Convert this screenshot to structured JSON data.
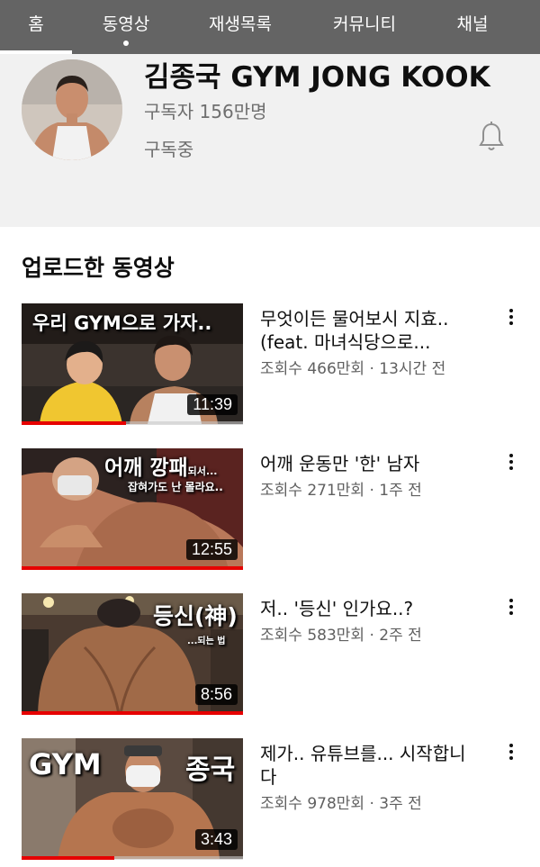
{
  "tabs": [
    {
      "label": "홈",
      "active": true
    },
    {
      "label": "동영상",
      "active": false
    },
    {
      "label": "재생목록",
      "active": false
    },
    {
      "label": "커뮤니티",
      "active": false
    },
    {
      "label": "채널",
      "active": false
    }
  ],
  "channel": {
    "title": "김종국 GYM JONG KOOK",
    "subscribers": "구독자 156만명",
    "subscribe_status": "구독중"
  },
  "section_title": "업로드한 동영상",
  "videos": [
    {
      "title": "무엇이든 물어보시 지효.. (feat. 마녀식당으로...",
      "meta": "조회수 466만회 · 13시간 전",
      "duration": "11:39",
      "watch_progress": 0.47,
      "thumb_text": "우리 GYM으로 가자.."
    },
    {
      "title": "어깨 운동만 '한' 남자",
      "meta": "조회수 271만회 · 1주 전",
      "duration": "12:55",
      "watch_progress": 1.0,
      "thumb_text": "어깨 깡패",
      "thumb_text_small": "되서...",
      "thumb_subtext": "잡혀가도 난 몰라요.."
    },
    {
      "title": "저.. '등신' 인가요..?",
      "meta": "조회수 583만회 · 2주 전",
      "duration": "8:56",
      "watch_progress": 1.0,
      "thumb_text": "등신(神)",
      "thumb_subtext": "...되는 법"
    },
    {
      "title": "제가.. 유튜브를... 시작합니다",
      "meta": "조회수 978만회 · 3주 전",
      "duration": "3:43",
      "watch_progress": 0.42,
      "thumb_text_left": "GYM",
      "thumb_text_right": "종국"
    }
  ],
  "icons": {
    "bell": "bell-icon",
    "more": "more-vertical-icon"
  },
  "colors": {
    "tabbar": "#646464",
    "header_bg": "#f1f1f1",
    "progress": "#e60000"
  }
}
